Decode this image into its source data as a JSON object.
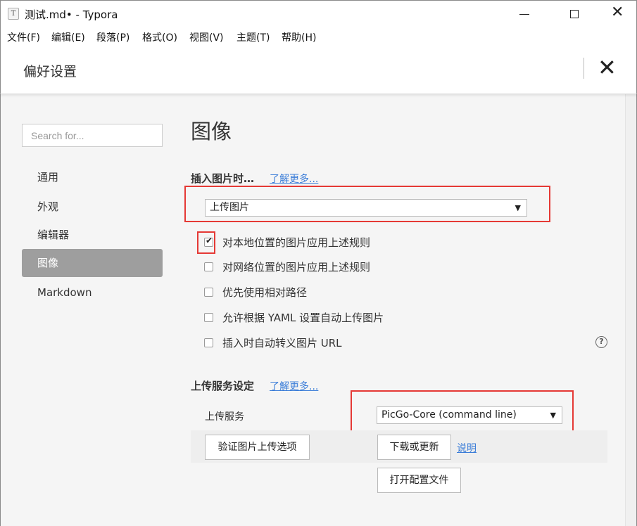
{
  "window": {
    "title": "测试.md• - Typora",
    "app_icon_glyph": "T",
    "minimize_icon": "minimize-icon",
    "maximize_icon": "maximize-icon",
    "close_icon": "close-icon"
  },
  "menu": [
    "文件(F)",
    "编辑(E)",
    "段落(P)",
    "格式(O)",
    "视图(V)",
    "主题(T)",
    "帮助(H)"
  ],
  "prefs": {
    "title": "偏好设置",
    "close_glyph": "✕"
  },
  "sidebar": {
    "search_placeholder": "Search for...",
    "items": [
      {
        "label": "通用",
        "active": false
      },
      {
        "label": "外观",
        "active": false
      },
      {
        "label": "编辑器",
        "active": false
      },
      {
        "label": "图像",
        "active": true
      },
      {
        "label": "Markdown",
        "active": false
      }
    ]
  },
  "main": {
    "section_title": "图像",
    "insert_group": {
      "title": "插入图片时…",
      "learn_more": "了解更多...",
      "select_value": "上传图片"
    },
    "checkboxes": [
      {
        "label": "对本地位置的图片应用上述规则",
        "checked": true
      },
      {
        "label": "对网络位置的图片应用上述规则",
        "checked": false
      },
      {
        "label": "优先使用相对路径",
        "checked": false
      },
      {
        "label": "允许根据 YAML 设置自动上传图片",
        "checked": false
      },
      {
        "label": "插入时自动转义图片 URL",
        "checked": false
      }
    ],
    "help_glyph": "?",
    "upload_group": {
      "title": "上传服务设定",
      "learn_more": "了解更多...",
      "service_label": "上传服务",
      "service_value": "PicGo-Core (command line)",
      "verify_button": "验证图片上传选项",
      "download_button": "下载或更新",
      "explain_link": "说明",
      "open_config_button": "打开配置文件"
    }
  },
  "colors": {
    "highlight_border": "#e53935",
    "active_sidebar": "#9e9e9e",
    "link": "#3b7dd8"
  }
}
